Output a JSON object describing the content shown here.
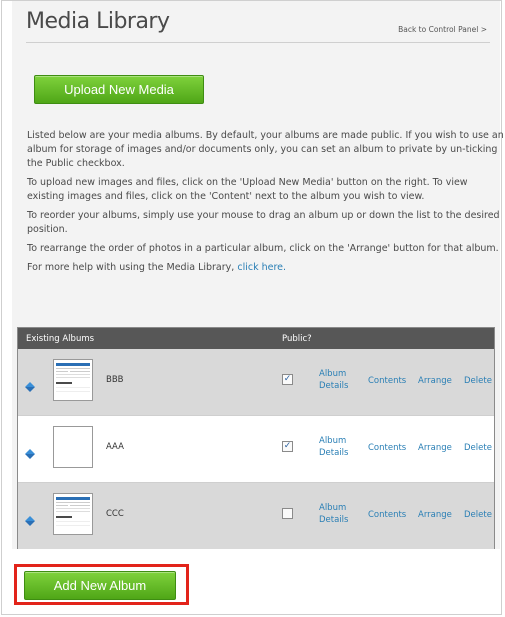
{
  "page": {
    "title": "Media Library",
    "back_link": "Back to Control Panel >"
  },
  "buttons": {
    "upload": "Upload New Media",
    "add_album": "Add New Album"
  },
  "description": {
    "p1": "Listed below are your media albums. By default, your albums are made public. If you wish to use an album for storage of images and/or documents only, you can set an album to private by un-ticking the Public checkbox.",
    "p2": "To upload new images and files, click on the 'Upload New Media' button on the right. To view existing images and files, click on the 'Content' next to the album you wish to view.",
    "p3": "To reorder your albums, simply use your mouse to drag an album up or down the list to the desired position.",
    "p4": "To rearrange the order of photos in a particular album, click on the 'Arrange' button for that album.",
    "p5_prefix": "For more help with using the Media Library,",
    "p5_link": "click here."
  },
  "table": {
    "headers": {
      "existing": "Existing Albums",
      "public": "Public?"
    },
    "rows": [
      {
        "name": "BBB",
        "public_checked": true,
        "thumbnail": "screenshot"
      },
      {
        "name": "AAA",
        "public_checked": true,
        "thumbnail": "blank"
      },
      {
        "name": "CCC",
        "public_checked": false,
        "thumbnail": "screenshot"
      }
    ],
    "actions": {
      "details_line1": "Album",
      "details_line2": "Details",
      "contents": "Contents",
      "arrange": "Arrange",
      "delete": "Delete"
    }
  },
  "icons": {
    "handle": "drag-handle-icon"
  },
  "colors": {
    "button_green": "#5cb82a",
    "link_blue": "#2a7fb5",
    "header_gray": "#575757",
    "highlight_red": "#e2231a"
  }
}
